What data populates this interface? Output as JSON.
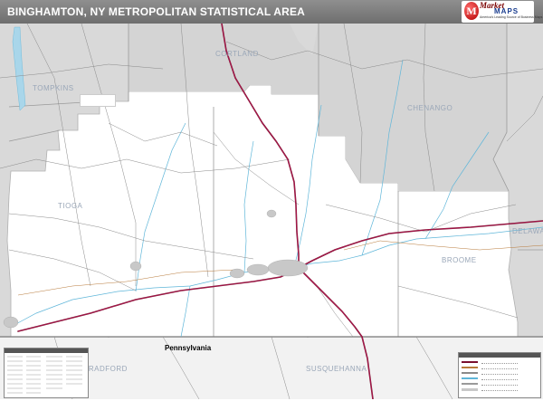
{
  "title": "BINGHAMTON, NY METROPOLITAN STATISTICAL AREA",
  "logo": {
    "brand_top": "Market",
    "brand_bottom": "MAPS",
    "tagline": "America's Leading Source of Business Maps"
  },
  "counties": {
    "cortland": "CORTLAND",
    "tompkins": "TOMPKINS",
    "chenango": "CHENANGO",
    "tioga": "TIOGA",
    "broome": "BROOME",
    "delaware": "DELAWARE",
    "bradford": "BRADFORD",
    "susquehanna": "SUSQUEHANNA"
  },
  "state_label": "Pennsylvania",
  "colors": {
    "title_bar": "#7a7a7a",
    "outside_area": "#d9d9d9",
    "msa_area": "#ffffff",
    "interstate": "#7a0f2e",
    "water": "#5fb6d9",
    "county_line": "#9a9a9a"
  }
}
